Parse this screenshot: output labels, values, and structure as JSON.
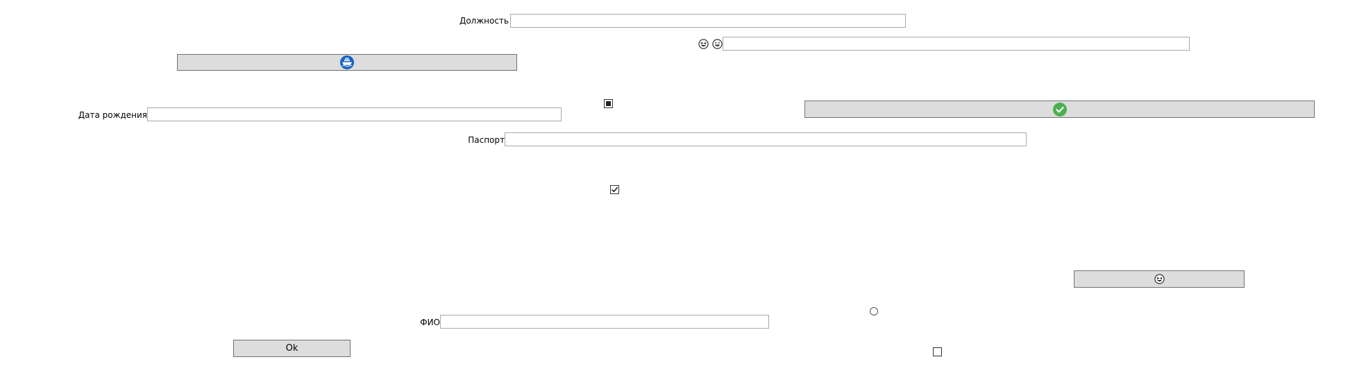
{
  "form": {
    "position_label": "Должность",
    "position_value": "",
    "birthdate_label": "Дата рождения",
    "birthdate_value": "",
    "passport_label": "Паспорт",
    "passport_value": "",
    "fio_label": "ФИО",
    "fio_value": "",
    "emoji_field_value": "",
    "ok_label": "Ok"
  },
  "checkboxes": {
    "top_state": "indeterminate",
    "middle_state": "checked",
    "bottom_state": "unchecked"
  },
  "radio": {
    "state": "unselected"
  },
  "icons": {
    "emoji_pair": [
      "grinning-squint-face-icon",
      "grinning-face-icon"
    ],
    "ship_button_icon": "ship-icon",
    "confirm_button_icon": "check-circle-icon",
    "emoji_button_icon": "grinning-squint-face-icon"
  },
  "colors": {
    "button_bg": "#dddddd",
    "ship_icon_blue": "#1565c0",
    "check_icon_green": "#4caf50"
  }
}
